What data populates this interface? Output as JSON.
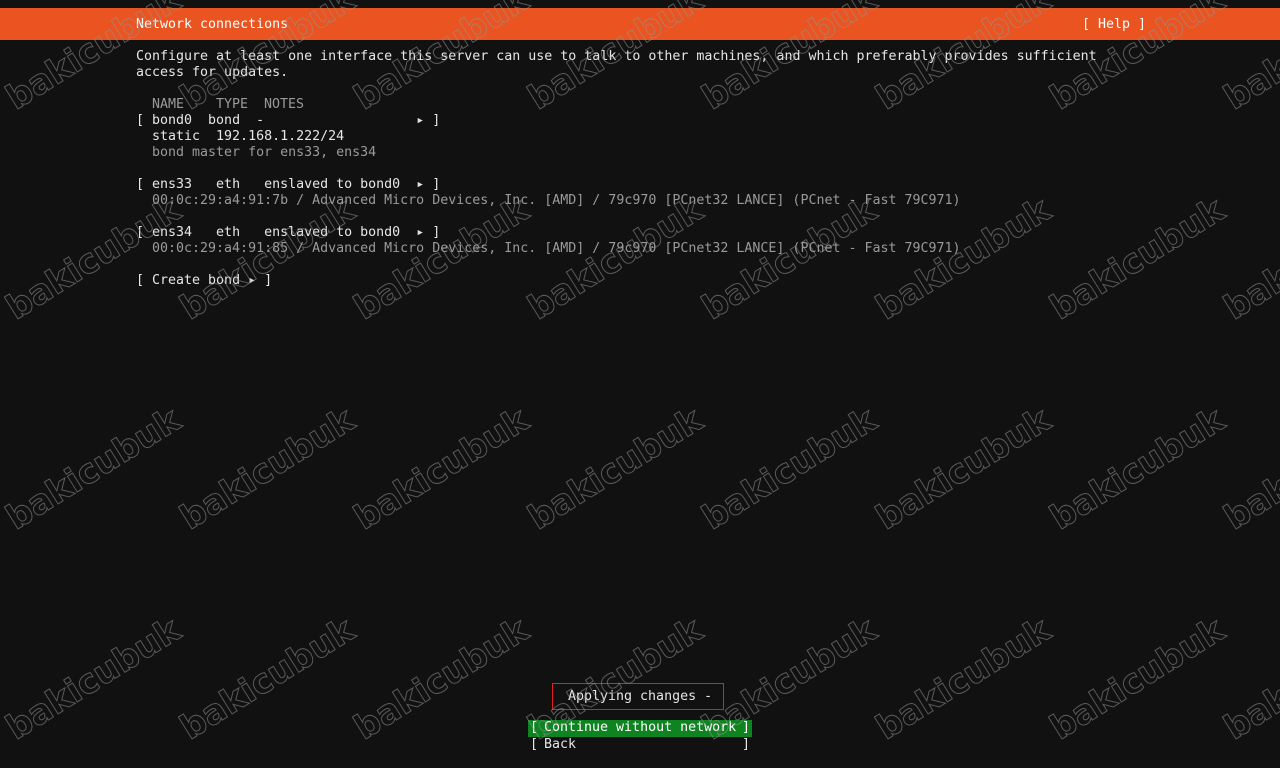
{
  "header": {
    "title": "Network connections",
    "help": "[ Help ]",
    "accent_color": "#e95420"
  },
  "intro": {
    "line1": "Configure at least one interface this server can use to talk to other machines, and which preferably provides sufficient",
    "line2": "access for updates."
  },
  "table": {
    "col_name": "NAME",
    "col_type": "TYPE",
    "col_notes": "NOTES"
  },
  "interfaces": [
    {
      "row": "[ bond0  bond  -                   ▸ ]",
      "detail1": "static  192.168.1.222/24",
      "detail2": "bond master for ens33, ens34"
    },
    {
      "row": "[ ens33   eth   enslaved to bond0  ▸ ]",
      "detail1": "00:0c:29:a4:91:7b / Advanced Micro Devices, Inc. [AMD] / 79c970 [PCnet32 LANCE] (PCnet - Fast 79C971)"
    },
    {
      "row": "[ ens34   eth   enslaved to bond0  ▸ ]",
      "detail1": "00:0c:29:a4:91:85 / Advanced Micro Devices, Inc. [AMD] / 79c970 [PCnet32 LANCE] (PCnet - Fast 79C971)"
    }
  ],
  "create_bond": "[ Create bond ▸ ]",
  "status": {
    "applying": "Applying changes -",
    "highlight_color": "#e02020"
  },
  "buttons": {
    "continue_label": "Continue without network",
    "back_label": "Back",
    "bracket_open": "[",
    "bracket_close": "]",
    "selected_color": "#0e8420"
  },
  "watermark": {
    "text": "bakicubuk"
  }
}
